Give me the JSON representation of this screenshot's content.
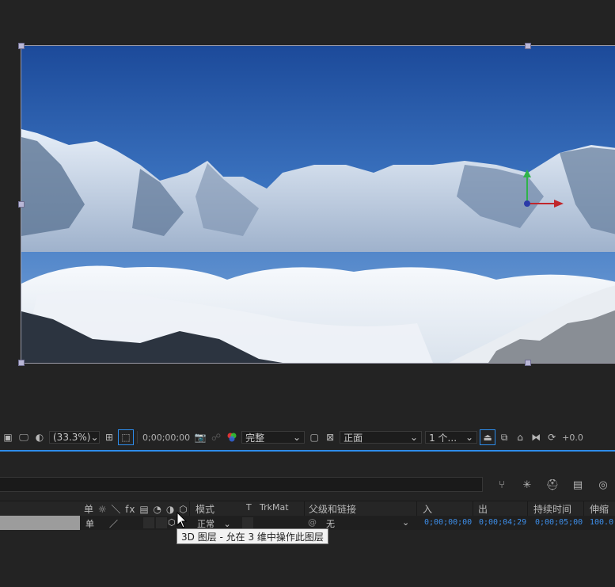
{
  "viewer_toolbar": {
    "zoom": "(33.3%)",
    "timecode": "0;00;00;00",
    "resolution": "完整",
    "view": "正面",
    "views_count": "1 个...",
    "exposure": "+0.0"
  },
  "timeline": {
    "columns": {
      "switches_icons": "单 ☼ ＼ fx",
      "mode": "模式",
      "t": "T",
      "trkmat": "TrkMat",
      "parent": "父级和链接",
      "in": "入",
      "out": "出",
      "duration": "持续时间",
      "stretch": "伸缩"
    },
    "layer": {
      "mode": "正常",
      "parent": "无",
      "in": "0;00;00;00",
      "out": "0;00;04;29",
      "duration": "0;00;05;00",
      "stretch": "100.0"
    }
  },
  "tooltip": "3D 图层 - 允在 3 维中操作此图层",
  "colors": {
    "accent": "#2d8ceb",
    "sky_top": "#1f4fa0",
    "panel_bg": "#232323"
  }
}
